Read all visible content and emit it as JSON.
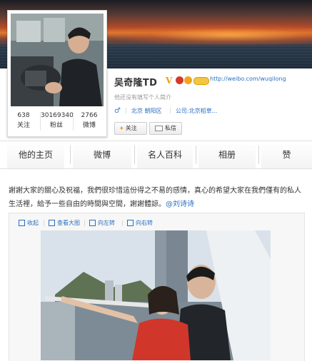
{
  "profile": {
    "name": "吴奇隆TD",
    "blog_url": "http://weibo.com/wuqilong",
    "bio": "他还没有填写个人简介",
    "gender_icon": "♂",
    "location": "北京 朝阳区",
    "company": "公司:北京稻草...",
    "stats": [
      {
        "value": "638",
        "label": "关注"
      },
      {
        "value": "30169340",
        "label": "粉丝"
      },
      {
        "value": "2766",
        "label": "微博"
      }
    ],
    "follow_label": "关注",
    "message_label": "私信",
    "badge_letter": "V"
  },
  "tabs": [
    {
      "label": "他的主页"
    },
    {
      "label": "微博"
    },
    {
      "label": "名人百科"
    },
    {
      "label": "相册"
    },
    {
      "label": "赞"
    }
  ],
  "post": {
    "text": "謝謝大家的關心及祝福，我們很珍惜這份得之不易的感情，真心的希望大家在我們僅有的私人生活裡，給予一些自由的時間與空間，謝謝體諒。",
    "mention": "@刘诗诗",
    "actions": [
      "收起",
      "查看大图",
      "向左转",
      "向右转"
    ]
  },
  "colors": {
    "link": "#2a6ebf",
    "badge_gold": "#f0a400",
    "follow_plus": "#f08200"
  },
  "icons": [
    "avatar-photo",
    "verified-v-icon",
    "weibo-badge-icon",
    "male-icon",
    "plus-icon",
    "envelope-icon"
  ]
}
